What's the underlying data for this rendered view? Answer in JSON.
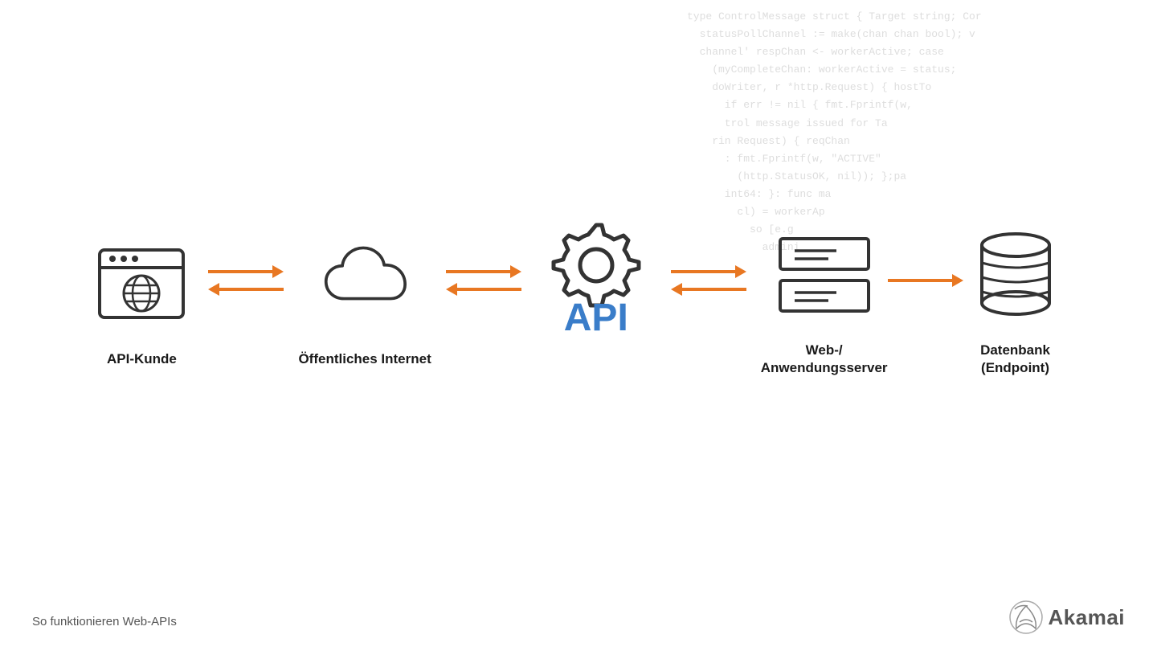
{
  "code_lines": [
    "type ControlMessage struct { Target string; Cor",
    "  statusPollChannel := make(chan chan bool); v",
    "  channel' respChan <- workerActive; case",
    "    (myCompleteChan: workerActive = status;",
    "    doWriter, r *http.Request) { hostTo",
    "      if err != nil { fmt.Fprintf(w,",
    "      trol message issued for Ta",
    "    rin Request) { reqChan",
    "      : fmt.Fprintf(w, \"ACTIVE\"",
    "        (http.StatusOK, nil)); };pa",
    "      int64: }: func ma",
    "        cl) = workerAp",
    "          so [e.g",
    "            admini"
  ],
  "diagram": {
    "items": [
      {
        "id": "api-kunde",
        "label": "API-Kunde",
        "type": "browser"
      },
      {
        "id": "internet",
        "label": "Öffentliches Internet",
        "type": "cloud"
      },
      {
        "id": "api",
        "label": "API",
        "type": "gear"
      },
      {
        "id": "webserver",
        "label": "Web-/\nAnwendungsserver",
        "type": "servers"
      },
      {
        "id": "datenbank",
        "label": "Datenbank\n(Endpoint)",
        "type": "database"
      }
    ],
    "connectors": [
      {
        "type": "double",
        "between": "api-kunde|internet"
      },
      {
        "type": "double",
        "between": "internet|api"
      },
      {
        "type": "double",
        "between": "api|webserver"
      },
      {
        "type": "single",
        "between": "webserver|datenbank"
      }
    ]
  },
  "footer": {
    "left_text": "So funktionieren Web-APIs",
    "logo_text": "Akamai"
  },
  "colors": {
    "orange": "#E87722",
    "blue": "#3a7dc9",
    "dark": "#1a1a1a",
    "gray": "#555555",
    "code_color": "#cccccc"
  }
}
